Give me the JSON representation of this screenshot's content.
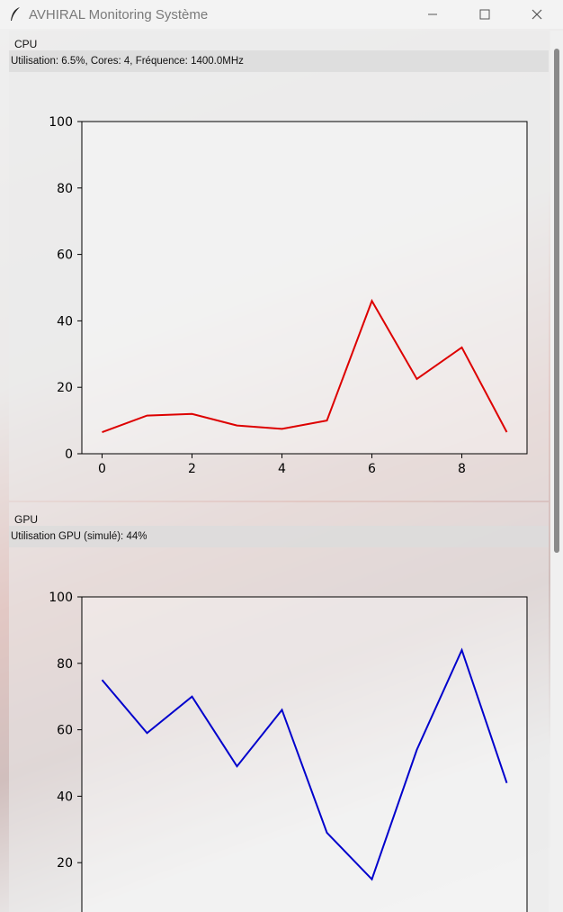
{
  "window": {
    "title": "AVHIRAL Monitoring Système"
  },
  "cpu": {
    "label": "CPU",
    "info": "Utilisation: 6.5%, Cores: 4, Fréquence: 1400.0MHz"
  },
  "gpu": {
    "label": "GPU",
    "info": "Utilisation GPU (simulé): 44%"
  },
  "chart_data": [
    {
      "type": "line",
      "x": [
        0,
        1,
        2,
        3,
        4,
        5,
        6,
        7,
        8,
        9
      ],
      "series": [
        {
          "values": [
            6.5,
            11.5,
            12,
            8.5,
            7.5,
            10,
            46,
            22.5,
            32,
            6.5
          ],
          "color": "#dd0000"
        }
      ],
      "xticks": [
        0,
        2,
        4,
        6,
        8
      ],
      "yticks": [
        0,
        20,
        40,
        60,
        80,
        100
      ],
      "xlim": [
        -0.45,
        9.45
      ],
      "ylim": [
        0,
        100
      ],
      "grid": false
    },
    {
      "type": "line",
      "x": [
        0,
        1,
        2,
        3,
        4,
        5,
        6,
        7,
        8,
        9
      ],
      "series": [
        {
          "values": [
            75,
            59,
            70,
            49,
            66,
            29,
            15,
            54,
            84,
            44
          ],
          "color": "#0000cc"
        }
      ],
      "yticks": [
        20,
        40,
        60,
        80,
        100
      ],
      "xlim": [
        -0.45,
        9.45
      ],
      "ylim": [
        0,
        100
      ],
      "grid": false
    }
  ]
}
